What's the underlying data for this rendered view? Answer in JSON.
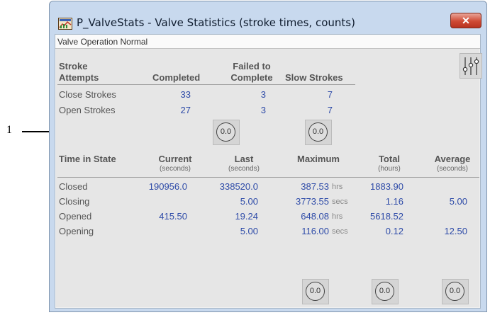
{
  "callout": {
    "label": "1"
  },
  "window": {
    "title": "P_ValveStats - Valve Statistics (stroke times, counts)",
    "close_glyph": "✕",
    "status": "Valve Operation Normal"
  },
  "strokes": {
    "header_label_l1": "Stroke",
    "header_label_l2": "Attempts",
    "header_completed": "Completed",
    "header_failed_l1": "Failed to",
    "header_failed_l2": "Complete",
    "header_slow": "Slow Strokes",
    "rows": [
      {
        "label": "Close Strokes",
        "completed": "33",
        "failed": "3",
        "slow": "7"
      },
      {
        "label": "Open Strokes",
        "completed": "27",
        "failed": "3",
        "slow": "7"
      }
    ]
  },
  "time_in_state": {
    "header_label": "Time in State",
    "header_current": "Current",
    "header_current_unit": "(seconds)",
    "header_last": "Last",
    "header_last_unit": "(seconds)",
    "header_maximum": "Maximum",
    "header_total": "Total",
    "header_total_unit": "(hours)",
    "header_average": "Average",
    "header_average_unit": "(seconds)",
    "rows": [
      {
        "label": "Closed",
        "current": "190956.0",
        "last": "338520.0",
        "maximum": "387.53",
        "max_unit": "hrs",
        "total": "1883.90",
        "average": ""
      },
      {
        "label": "Closing",
        "current": "",
        "last": "5.00",
        "maximum": "3773.55",
        "max_unit": "secs",
        "total": "1.16",
        "average": "5.00"
      },
      {
        "label": "Opened",
        "current": "415.50",
        "last": "19.24",
        "maximum": "648.08",
        "max_unit": "hrs",
        "total": "5618.52",
        "average": ""
      },
      {
        "label": "Opening",
        "current": "",
        "last": "5.00",
        "maximum": "116.00",
        "max_unit": "secs",
        "total": "0.12",
        "average": "12.50"
      }
    ]
  },
  "reset_button_label": "0.0",
  "icons": {
    "app": "valve-stats-app-icon",
    "close": "close-icon",
    "tune": "sliders-icon",
    "reset": "reset-counter-icon"
  }
}
